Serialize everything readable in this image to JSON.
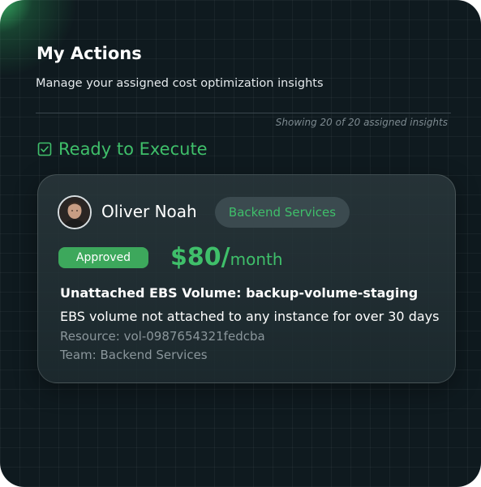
{
  "header": {
    "title": "My Actions",
    "subtitle": "Manage your assigned cost optimization insights",
    "count_text": "Showing 20 of 20 assigned insights"
  },
  "section": {
    "label": "Ready to Execute",
    "icon": "checkbox-checked-icon"
  },
  "insight": {
    "assignee": "Oliver Noah",
    "team_tag": "Backend Services",
    "status": "Approved",
    "amount": "$80/",
    "period": "month",
    "title": "Unattached EBS Volume: backup-volume-staging",
    "description": "EBS volume not attached to any instance for over 30 days",
    "resource": "Resource: vol-0987654321fedcba",
    "team": "Team: Backend Services"
  },
  "colors": {
    "accent_green": "#3fbf6a",
    "status_green": "#3da85c",
    "background": "#0f1a1f"
  }
}
